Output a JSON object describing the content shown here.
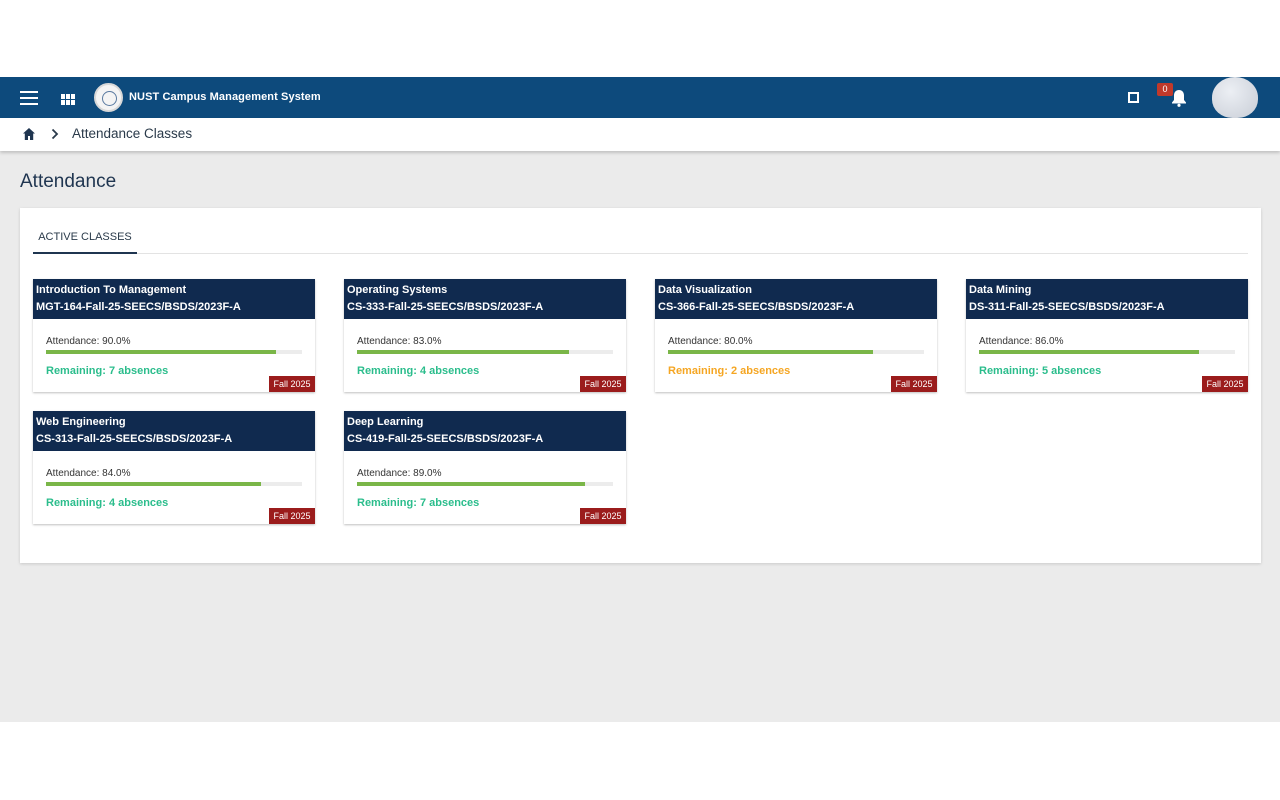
{
  "header": {
    "app_title": "NUST Campus Management System",
    "notification_count": "0",
    "icons": [
      "menu-icon",
      "apps-grid-icon",
      "logo",
      "fullscreen-icon",
      "bell-icon",
      "avatar"
    ]
  },
  "breadcrumb": {
    "current": "Attendance Classes"
  },
  "page": {
    "title": "Attendance"
  },
  "tabs": [
    {
      "label": "ACTIVE CLASSES",
      "active": true
    }
  ],
  "colors": {
    "header_bg": "#0d4a7c",
    "card_head_bg": "#102a4f",
    "progress": "#7ab648",
    "remaining_ok": "#2bbd8c",
    "remaining_warn": "#f5a623",
    "term_badge": "#9b1c1c"
  },
  "classes": [
    {
      "title": "Introduction To Management",
      "code": "MGT-164-Fall-25-SEECS/BSDS/2023F-A",
      "attendance_label": "Attendance: 90.0%",
      "attendance": 90.0,
      "remaining": "Remaining: 7 absences",
      "status": "ok",
      "term": "Fall 2025"
    },
    {
      "title": "Operating Systems",
      "code": "CS-333-Fall-25-SEECS/BSDS/2023F-A",
      "attendance_label": "Attendance: 83.0%",
      "attendance": 83.0,
      "remaining": "Remaining: 4 absences",
      "status": "ok",
      "term": "Fall 2025"
    },
    {
      "title": "Data Visualization",
      "code": "CS-366-Fall-25-SEECS/BSDS/2023F-A",
      "attendance_label": "Attendance: 80.0%",
      "attendance": 80.0,
      "remaining": "Remaining: 2 absences",
      "status": "warn",
      "term": "Fall 2025"
    },
    {
      "title": "Data Mining",
      "code": "DS-311-Fall-25-SEECS/BSDS/2023F-A",
      "attendance_label": "Attendance: 86.0%",
      "attendance": 86.0,
      "remaining": "Remaining: 5 absences",
      "status": "ok",
      "term": "Fall 2025"
    },
    {
      "title": "Web Engineering",
      "code": "CS-313-Fall-25-SEECS/BSDS/2023F-A",
      "attendance_label": "Attendance: 84.0%",
      "attendance": 84.0,
      "remaining": "Remaining: 4 absences",
      "status": "ok",
      "term": "Fall 2025"
    },
    {
      "title": "Deep Learning",
      "code": "CS-419-Fall-25-SEECS/BSDS/2023F-A",
      "attendance_label": "Attendance: 89.0%",
      "attendance": 89.0,
      "remaining": "Remaining: 7 absences",
      "status": "ok",
      "term": "Fall 2025"
    }
  ]
}
